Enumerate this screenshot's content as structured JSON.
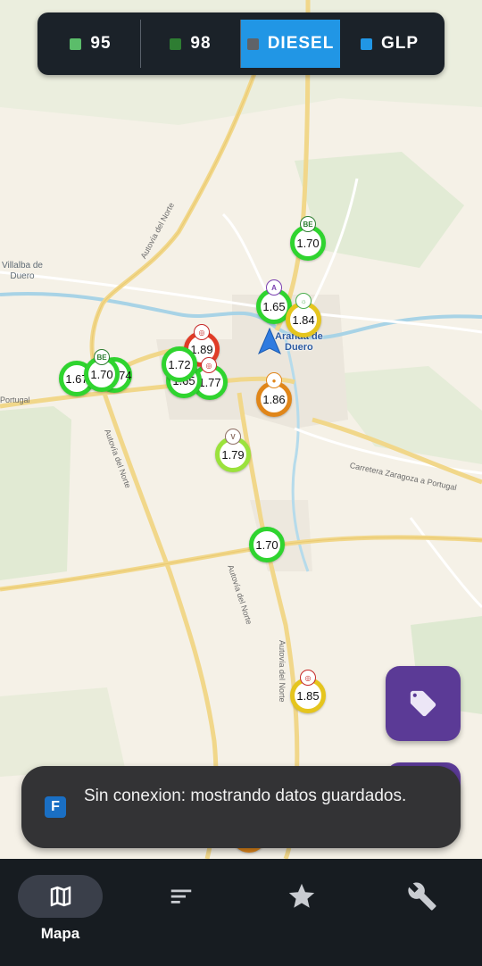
{
  "fuel_tabs": [
    {
      "label": "95",
      "color": "#5bbd6a",
      "active": false
    },
    {
      "label": "98",
      "color": "#2e7d32",
      "active": false
    },
    {
      "label": "DIESEL",
      "color": "#5f6368",
      "active": true
    },
    {
      "label": "GLP",
      "color": "#2196e5",
      "active": false
    }
  ],
  "map_labels": {
    "villalba": "Villalba de\nDuero",
    "aranda": "Aranda de\nDuero",
    "portugal": "Portugal",
    "autovia_1": "Autovía del Norte",
    "autovia_2": "Autovía del Norte",
    "autovia_3": "Autovía del Norte",
    "autovia_4": "Autovía del Norte",
    "carretera": "Carretera Zaragoza a Portugal"
  },
  "stations": [
    {
      "price": "1.70",
      "color": "green",
      "brand": "BE"
    },
    {
      "price": "1.65",
      "color": "green",
      "brand": "A"
    },
    {
      "price": "1.84",
      "color": "yellow",
      "brand": "sun"
    },
    {
      "price": "1.89",
      "color": "red",
      "brand": "C"
    },
    {
      "price": "1.72",
      "color": "green",
      "brand": ""
    },
    {
      "price": "1.65",
      "color": "green",
      "brand": ""
    },
    {
      "price": "1.77",
      "color": "green",
      "brand": "C"
    },
    {
      "price": "1.86",
      "color": "orange",
      "brand": "drop"
    },
    {
      "price": "1.67",
      "color": "green",
      "brand": ""
    },
    {
      "price": "1.70",
      "color": "green",
      "brand": "BE"
    },
    {
      "price": "1.74",
      "color": "green",
      "brand": ""
    },
    {
      "price": "1.79",
      "color": "lime",
      "brand": "V"
    },
    {
      "price": "1.70",
      "color": "green",
      "brand": ""
    },
    {
      "price": "1.85",
      "color": "yellow",
      "brand": "C"
    }
  ],
  "snackbar": {
    "app_icon": "F",
    "message": "Sin conexion: mostrando datos guardados."
  },
  "bottom_nav": [
    {
      "label": "Mapa",
      "icon": "map-icon",
      "active": true
    },
    {
      "label": "",
      "icon": "list-sort-icon",
      "active": false
    },
    {
      "label": "",
      "icon": "star-icon",
      "active": false
    },
    {
      "label": "",
      "icon": "wrench-icon",
      "active": false
    }
  ],
  "colors": {
    "accent": "#2196e5",
    "fab": "#5b3a96",
    "nav_bg": "#171c21",
    "price_green": "#2fd42f",
    "price_lime": "#9be23c",
    "price_yellow": "#e5c51e",
    "price_orange": "#e0861a",
    "price_red": "#e03c27"
  }
}
